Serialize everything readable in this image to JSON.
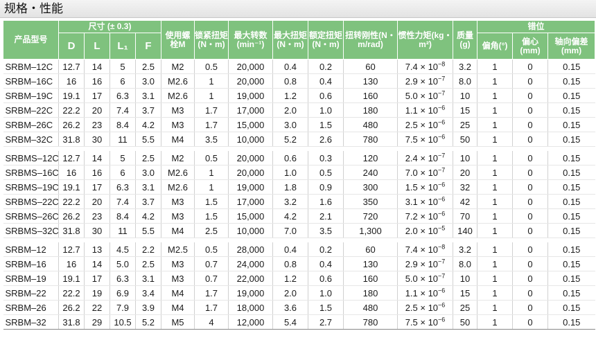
{
  "title": "规格・性能",
  "headers": {
    "model": "产品型号",
    "dimensions": "尺寸 (± 0.3)",
    "dims": [
      "D",
      "L",
      "L₁",
      "F"
    ],
    "bolt": "使用螺栓M",
    "lock_torque": "锁紧扭矩(N・m)",
    "max_speed": "最大转数(min⁻¹)",
    "max_torque": "最大扭矩(N・m)",
    "rated_torque": "额定扭矩(N・m)",
    "torsional_stiffness": "扭转刚性(N・m/rad)",
    "inertia": "惯性力矩(kg・m²)",
    "mass": "质量(g)",
    "misalignment": "错位",
    "angular": "偏角(°)",
    "eccentric": "偏心(mm)",
    "axial": "轴向偏差(mm)"
  },
  "groups": [
    [
      [
        "SRBM–12C",
        "12.7",
        "14",
        "5",
        "2.5",
        "M2",
        "0.5",
        "20,000",
        "0.4",
        "0.2",
        "60",
        "7.4",
        "−8",
        "3.2",
        "1",
        "0",
        "0.15"
      ],
      [
        "SRBM–16C",
        "16",
        "16",
        "6",
        "3.0",
        "M2.6",
        "1",
        "20,000",
        "0.8",
        "0.4",
        "130",
        "2.9",
        "−7",
        "8.0",
        "1",
        "0",
        "0.15"
      ],
      [
        "SRBM–19C",
        "19.1",
        "17",
        "6.3",
        "3.1",
        "M2.6",
        "1",
        "19,000",
        "1.2",
        "0.6",
        "160",
        "5.0",
        "−7",
        "10",
        "1",
        "0",
        "0.15"
      ],
      [
        "SRBM–22C",
        "22.2",
        "20",
        "7.4",
        "3.7",
        "M3",
        "1.7",
        "17,000",
        "2.0",
        "1.0",
        "180",
        "1.1",
        "−6",
        "15",
        "1",
        "0",
        "0.15"
      ],
      [
        "SRBM–26C",
        "26.2",
        "23",
        "8.4",
        "4.2",
        "M3",
        "1.7",
        "15,000",
        "3.0",
        "1.5",
        "480",
        "2.5",
        "−6",
        "25",
        "1",
        "0",
        "0.15"
      ],
      [
        "SRBM–32C",
        "31.8",
        "30",
        "11",
        "5.5",
        "M4",
        "3.5",
        "10,000",
        "5.2",
        "2.6",
        "780",
        "7.5",
        "−6",
        "50",
        "1",
        "0",
        "0.15"
      ]
    ],
    [
      [
        "SRBMS–12C",
        "12.7",
        "14",
        "5",
        "2.5",
        "M2",
        "0.5",
        "20,000",
        "0.6",
        "0.3",
        "120",
        "2.4",
        "−7",
        "10",
        "1",
        "0",
        "0.15"
      ],
      [
        "SRBMS–16C",
        "16",
        "16",
        "6",
        "3.0",
        "M2.6",
        "1",
        "20,000",
        "1.0",
        "0.5",
        "240",
        "7.0",
        "−7",
        "20",
        "1",
        "0",
        "0.15"
      ],
      [
        "SRBMS–19C",
        "19.1",
        "17",
        "6.3",
        "3.1",
        "M2.6",
        "1",
        "19,000",
        "1.8",
        "0.9",
        "300",
        "1.5",
        "−6",
        "32",
        "1",
        "0",
        "0.15"
      ],
      [
        "SRBMS–22C",
        "22.2",
        "20",
        "7.4",
        "3.7",
        "M3",
        "1.5",
        "17,000",
        "3.2",
        "1.6",
        "350",
        "3.1",
        "−6",
        "42",
        "1",
        "0",
        "0.15"
      ],
      [
        "SRBMS–26C",
        "26.2",
        "23",
        "8.4",
        "4.2",
        "M3",
        "1.5",
        "15,000",
        "4.2",
        "2.1",
        "720",
        "7.2",
        "−6",
        "70",
        "1",
        "0",
        "0.15"
      ],
      [
        "SRBMS–32C",
        "31.8",
        "30",
        "11",
        "5.5",
        "M4",
        "2.5",
        "10,000",
        "7.0",
        "3.5",
        "1,300",
        "2.0",
        "−5",
        "140",
        "1",
        "0",
        "0.15"
      ]
    ],
    [
      [
        "SRBM–12",
        "12.7",
        "13",
        "4.5",
        "2.2",
        "M2.5",
        "0.5",
        "28,000",
        "0.4",
        "0.2",
        "60",
        "7.4",
        "−8",
        "3.2",
        "1",
        "0",
        "0.15"
      ],
      [
        "SRBM–16",
        "16",
        "14",
        "5.0",
        "2.5",
        "M3",
        "0.7",
        "24,000",
        "0.8",
        "0.4",
        "130",
        "2.9",
        "−7",
        "8.0",
        "1",
        "0",
        "0.15"
      ],
      [
        "SRBM–19",
        "19.1",
        "17",
        "6.3",
        "3.1",
        "M3",
        "0.7",
        "22,000",
        "1.2",
        "0.6",
        "160",
        "5.0",
        "−7",
        "10",
        "1",
        "0",
        "0.15"
      ],
      [
        "SRBM–22",
        "22.2",
        "19",
        "6.9",
        "3.4",
        "M4",
        "1.7",
        "19,000",
        "2.0",
        "1.0",
        "180",
        "1.1",
        "−6",
        "15",
        "1",
        "0",
        "0.15"
      ],
      [
        "SRBM–26",
        "26.2",
        "22",
        "7.9",
        "3.9",
        "M4",
        "1.7",
        "18,000",
        "3.6",
        "1.5",
        "480",
        "2.5",
        "−6",
        "25",
        "1",
        "0",
        "0.15"
      ],
      [
        "SRBM–32",
        "31.8",
        "29",
        "10.5",
        "5.2",
        "M5",
        "4",
        "12,000",
        "5.4",
        "2.7",
        "780",
        "7.5",
        "−6",
        "50",
        "1",
        "0",
        "0.15"
      ]
    ]
  ]
}
